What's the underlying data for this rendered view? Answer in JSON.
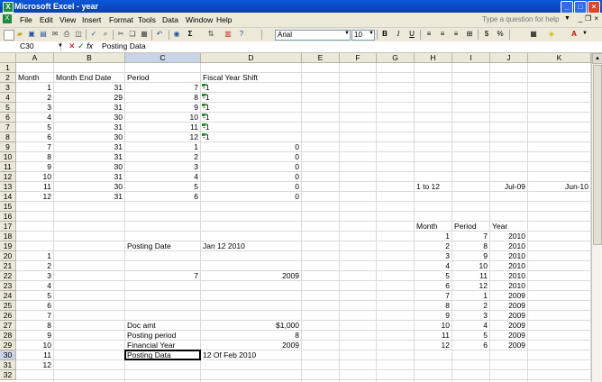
{
  "window": {
    "title": "Microsoft Excel - year"
  },
  "menu": [
    "File",
    "Edit",
    "View",
    "Insert",
    "Format",
    "Tools",
    "Data",
    "Window",
    "Help"
  ],
  "help_placeholder": "Type a question for help",
  "toolbar": {
    "font": "Arial",
    "size": "10",
    "bold": "B",
    "italic": "I",
    "underline": "U",
    "currency": "$",
    "percent": "%",
    "sigma": "Σ"
  },
  "formula_bar": {
    "name_box": "C30",
    "fx": "fx",
    "content": "Posting Data"
  },
  "columns": [
    "A",
    "B",
    "C",
    "D",
    "E",
    "F",
    "G",
    "H",
    "I",
    "J",
    "K"
  ],
  "rows": [
    "1",
    "2",
    "3",
    "4",
    "5",
    "6",
    "7",
    "8",
    "9",
    "10",
    "11",
    "12",
    "13",
    "14",
    "15",
    "16",
    "17",
    "18",
    "19",
    "20",
    "21",
    "22",
    "23",
    "24",
    "25",
    "26",
    "27",
    "28",
    "29",
    "30",
    "31",
    "32"
  ],
  "cells": [
    {
      "c": "A",
      "r": 2,
      "v": "Month",
      "t": "txt"
    },
    {
      "c": "B",
      "r": 2,
      "v": "Month End Date",
      "t": "txt"
    },
    {
      "c": "C",
      "r": 2,
      "v": "Period",
      "t": "txt"
    },
    {
      "c": "D",
      "r": 2,
      "v": "Fiscal Year Shift",
      "t": "txt"
    },
    {
      "c": "A",
      "r": 3,
      "v": "1",
      "t": "num"
    },
    {
      "c": "B",
      "r": 3,
      "v": "31",
      "t": "num"
    },
    {
      "c": "C",
      "r": 3,
      "v": "7",
      "t": "num"
    },
    {
      "c": "D",
      "r": 3,
      "v": "-1",
      "t": "txt"
    },
    {
      "c": "A",
      "r": 4,
      "v": "2",
      "t": "num"
    },
    {
      "c": "B",
      "r": 4,
      "v": "29",
      "t": "num"
    },
    {
      "c": "C",
      "r": 4,
      "v": "8",
      "t": "num"
    },
    {
      "c": "D",
      "r": 4,
      "v": "-1",
      "t": "txt"
    },
    {
      "c": "A",
      "r": 5,
      "v": "3",
      "t": "num"
    },
    {
      "c": "B",
      "r": 5,
      "v": "31",
      "t": "num"
    },
    {
      "c": "C",
      "r": 5,
      "v": "9",
      "t": "num"
    },
    {
      "c": "D",
      "r": 5,
      "v": "-1",
      "t": "txt"
    },
    {
      "c": "A",
      "r": 6,
      "v": "4",
      "t": "num"
    },
    {
      "c": "B",
      "r": 6,
      "v": "30",
      "t": "num"
    },
    {
      "c": "C",
      "r": 6,
      "v": "10",
      "t": "num"
    },
    {
      "c": "D",
      "r": 6,
      "v": "-1",
      "t": "txt"
    },
    {
      "c": "A",
      "r": 7,
      "v": "5",
      "t": "num"
    },
    {
      "c": "B",
      "r": 7,
      "v": "31",
      "t": "num"
    },
    {
      "c": "C",
      "r": 7,
      "v": "11",
      "t": "num"
    },
    {
      "c": "D",
      "r": 7,
      "v": "-1",
      "t": "txt"
    },
    {
      "c": "A",
      "r": 8,
      "v": "6",
      "t": "num"
    },
    {
      "c": "B",
      "r": 8,
      "v": "30",
      "t": "num"
    },
    {
      "c": "C",
      "r": 8,
      "v": "12",
      "t": "num"
    },
    {
      "c": "D",
      "r": 8,
      "v": "-1",
      "t": "txt"
    },
    {
      "c": "A",
      "r": 9,
      "v": "7",
      "t": "num"
    },
    {
      "c": "B",
      "r": 9,
      "v": "31",
      "t": "num"
    },
    {
      "c": "C",
      "r": 9,
      "v": "1",
      "t": "num"
    },
    {
      "c": "D",
      "r": 9,
      "v": "0",
      "t": "num"
    },
    {
      "c": "A",
      "r": 10,
      "v": "8",
      "t": "num"
    },
    {
      "c": "B",
      "r": 10,
      "v": "31",
      "t": "num"
    },
    {
      "c": "C",
      "r": 10,
      "v": "2",
      "t": "num"
    },
    {
      "c": "D",
      "r": 10,
      "v": "0",
      "t": "num"
    },
    {
      "c": "A",
      "r": 11,
      "v": "9",
      "t": "num"
    },
    {
      "c": "B",
      "r": 11,
      "v": "30",
      "t": "num"
    },
    {
      "c": "C",
      "r": 11,
      "v": "3",
      "t": "num"
    },
    {
      "c": "D",
      "r": 11,
      "v": "0",
      "t": "num"
    },
    {
      "c": "A",
      "r": 12,
      "v": "10",
      "t": "num"
    },
    {
      "c": "B",
      "r": 12,
      "v": "31",
      "t": "num"
    },
    {
      "c": "C",
      "r": 12,
      "v": "4",
      "t": "num"
    },
    {
      "c": "D",
      "r": 12,
      "v": "0",
      "t": "num"
    },
    {
      "c": "A",
      "r": 13,
      "v": "11",
      "t": "num"
    },
    {
      "c": "B",
      "r": 13,
      "v": "30",
      "t": "num"
    },
    {
      "c": "C",
      "r": 13,
      "v": "5",
      "t": "num"
    },
    {
      "c": "D",
      "r": 13,
      "v": "0",
      "t": "num"
    },
    {
      "c": "H",
      "r": 13,
      "v": "1 to 12",
      "t": "txt"
    },
    {
      "c": "J",
      "r": 13,
      "v": "Jul-09",
      "t": "num"
    },
    {
      "c": "K",
      "r": 13,
      "v": "Jun-10",
      "t": "num"
    },
    {
      "c": "A",
      "r": 14,
      "v": "12",
      "t": "num"
    },
    {
      "c": "B",
      "r": 14,
      "v": "31",
      "t": "num"
    },
    {
      "c": "C",
      "r": 14,
      "v": "6",
      "t": "num"
    },
    {
      "c": "D",
      "r": 14,
      "v": "0",
      "t": "num"
    },
    {
      "c": "H",
      "r": 17,
      "v": "Month",
      "t": "txt"
    },
    {
      "c": "I",
      "r": 17,
      "v": "Period",
      "t": "txt"
    },
    {
      "c": "J",
      "r": 17,
      "v": "Year",
      "t": "txt"
    },
    {
      "c": "H",
      "r": 18,
      "v": "1",
      "t": "num"
    },
    {
      "c": "I",
      "r": 18,
      "v": "7",
      "t": "num"
    },
    {
      "c": "J",
      "r": 18,
      "v": "2010",
      "t": "num"
    },
    {
      "c": "C",
      "r": 19,
      "v": "Posting Date",
      "t": "txt"
    },
    {
      "c": "D",
      "r": 19,
      "v": "Jan 12 2010",
      "t": "txt"
    },
    {
      "c": "H",
      "r": 19,
      "v": "2",
      "t": "num"
    },
    {
      "c": "I",
      "r": 19,
      "v": "8",
      "t": "num"
    },
    {
      "c": "J",
      "r": 19,
      "v": "2010",
      "t": "num"
    },
    {
      "c": "A",
      "r": 20,
      "v": "1",
      "t": "num"
    },
    {
      "c": "H",
      "r": 20,
      "v": "3",
      "t": "num"
    },
    {
      "c": "I",
      "r": 20,
      "v": "9",
      "t": "num"
    },
    {
      "c": "J",
      "r": 20,
      "v": "2010",
      "t": "num"
    },
    {
      "c": "A",
      "r": 21,
      "v": "2",
      "t": "num"
    },
    {
      "c": "H",
      "r": 21,
      "v": "4",
      "t": "num"
    },
    {
      "c": "I",
      "r": 21,
      "v": "10",
      "t": "num"
    },
    {
      "c": "J",
      "r": 21,
      "v": "2010",
      "t": "num"
    },
    {
      "c": "A",
      "r": 22,
      "v": "3",
      "t": "num"
    },
    {
      "c": "C",
      "r": 22,
      "v": "7",
      "t": "num"
    },
    {
      "c": "D",
      "r": 22,
      "v": "2009",
      "t": "num"
    },
    {
      "c": "H",
      "r": 22,
      "v": "5",
      "t": "num"
    },
    {
      "c": "I",
      "r": 22,
      "v": "11",
      "t": "num"
    },
    {
      "c": "J",
      "r": 22,
      "v": "2010",
      "t": "num"
    },
    {
      "c": "A",
      "r": 23,
      "v": "4",
      "t": "num"
    },
    {
      "c": "H",
      "r": 23,
      "v": "6",
      "t": "num"
    },
    {
      "c": "I",
      "r": 23,
      "v": "12",
      "t": "num"
    },
    {
      "c": "J",
      "r": 23,
      "v": "2010",
      "t": "num"
    },
    {
      "c": "A",
      "r": 24,
      "v": "5",
      "t": "num"
    },
    {
      "c": "H",
      "r": 24,
      "v": "7",
      "t": "num"
    },
    {
      "c": "I",
      "r": 24,
      "v": "1",
      "t": "num"
    },
    {
      "c": "J",
      "r": 24,
      "v": "2009",
      "t": "num"
    },
    {
      "c": "A",
      "r": 25,
      "v": "6",
      "t": "num"
    },
    {
      "c": "H",
      "r": 25,
      "v": "8",
      "t": "num"
    },
    {
      "c": "I",
      "r": 25,
      "v": "2",
      "t": "num"
    },
    {
      "c": "J",
      "r": 25,
      "v": "2009",
      "t": "num"
    },
    {
      "c": "A",
      "r": 26,
      "v": "7",
      "t": "num"
    },
    {
      "c": "H",
      "r": 26,
      "v": "9",
      "t": "num"
    },
    {
      "c": "I",
      "r": 26,
      "v": "3",
      "t": "num"
    },
    {
      "c": "J",
      "r": 26,
      "v": "2009",
      "t": "num"
    },
    {
      "c": "A",
      "r": 27,
      "v": "8",
      "t": "num"
    },
    {
      "c": "C",
      "r": 27,
      "v": "Doc amt",
      "t": "txt"
    },
    {
      "c": "D",
      "r": 27,
      "v": "$1,000",
      "t": "num"
    },
    {
      "c": "H",
      "r": 27,
      "v": "10",
      "t": "num"
    },
    {
      "c": "I",
      "r": 27,
      "v": "4",
      "t": "num"
    },
    {
      "c": "J",
      "r": 27,
      "v": "2009",
      "t": "num"
    },
    {
      "c": "A",
      "r": 28,
      "v": "9",
      "t": "num"
    },
    {
      "c": "C",
      "r": 28,
      "v": "Posting period",
      "t": "txt"
    },
    {
      "c": "D",
      "r": 28,
      "v": "8",
      "t": "num"
    },
    {
      "c": "H",
      "r": 28,
      "v": "11",
      "t": "num"
    },
    {
      "c": "I",
      "r": 28,
      "v": "5",
      "t": "num"
    },
    {
      "c": "J",
      "r": 28,
      "v": "2009",
      "t": "num"
    },
    {
      "c": "A",
      "r": 29,
      "v": "10",
      "t": "num"
    },
    {
      "c": "C",
      "r": 29,
      "v": "Financial Year",
      "t": "txt"
    },
    {
      "c": "D",
      "r": 29,
      "v": "2009",
      "t": "num"
    },
    {
      "c": "H",
      "r": 29,
      "v": "12",
      "t": "num"
    },
    {
      "c": "I",
      "r": 29,
      "v": "6",
      "t": "num"
    },
    {
      "c": "J",
      "r": 29,
      "v": "2009",
      "t": "num"
    },
    {
      "c": "A",
      "r": 30,
      "v": "11",
      "t": "num"
    },
    {
      "c": "C",
      "r": 30,
      "v": "Posting Data",
      "t": "txt"
    },
    {
      "c": "D",
      "r": 30,
      "v": "12 Of Feb 2010",
      "t": "txt"
    },
    {
      "c": "A",
      "r": 31,
      "v": "12",
      "t": "num"
    }
  ],
  "active_cell": {
    "col": "C",
    "row": 30
  }
}
